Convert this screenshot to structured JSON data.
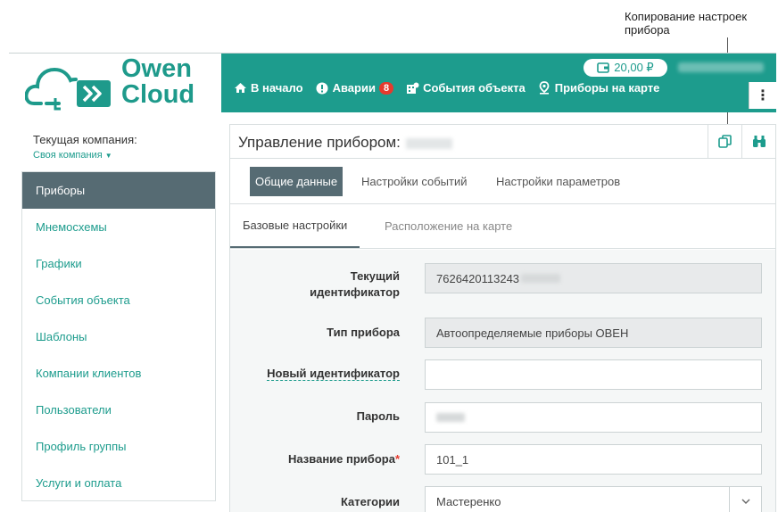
{
  "callout": {
    "text_line1": "Копирование настроек",
    "text_line2": "прибора"
  },
  "logo": {
    "line1": "Owen",
    "line2": "Cloud"
  },
  "topbar": {
    "balance": "20,00 ₽",
    "nav": [
      {
        "label": "В начало",
        "icon": "home-icon"
      },
      {
        "label": "Аварии",
        "icon": "alert-icon",
        "badge": "8"
      },
      {
        "label": "События объекта",
        "icon": "events-icon"
      },
      {
        "label": "Приборы на карте",
        "icon": "map-pin-icon"
      }
    ],
    "menu_glyph": "⋮"
  },
  "sidebar": {
    "company_label": "Текущая компания:",
    "company_link": "Своя компания",
    "items": [
      {
        "label": "Приборы",
        "active": true
      },
      {
        "label": "Мнемосхемы"
      },
      {
        "label": "Графики"
      },
      {
        "label": "События объекта"
      },
      {
        "label": "Шаблоны"
      },
      {
        "label": "Компании клиентов"
      },
      {
        "label": "Пользователи"
      },
      {
        "label": "Профиль группы"
      },
      {
        "label": "Услуги и оплата"
      }
    ]
  },
  "panel": {
    "title": "Управление прибором:",
    "tabs": [
      "Общие данные",
      "Настройки событий",
      "Настройки параметров"
    ],
    "subtabs": [
      "Базовые настройки",
      "Расположение на карте"
    ]
  },
  "form": {
    "current_id_label_1": "Текущий",
    "current_id_label_2": "идентификатор",
    "current_id_value": "7626420113243",
    "device_type_label": "Тип прибора",
    "device_type_value": "Автоопределяемые приборы ОВЕН",
    "new_id_label": "Новый идентификатор",
    "new_id_value": "",
    "password_label": "Пароль",
    "device_name_label": "Название прибора",
    "device_name_required": "*",
    "device_name_value": "101_1",
    "category_label": "Категории",
    "category_value": "Мастеренко"
  },
  "colors": {
    "accent": "#1d9c8d",
    "active_bg": "#566b73",
    "badge": "#e63a2e"
  }
}
